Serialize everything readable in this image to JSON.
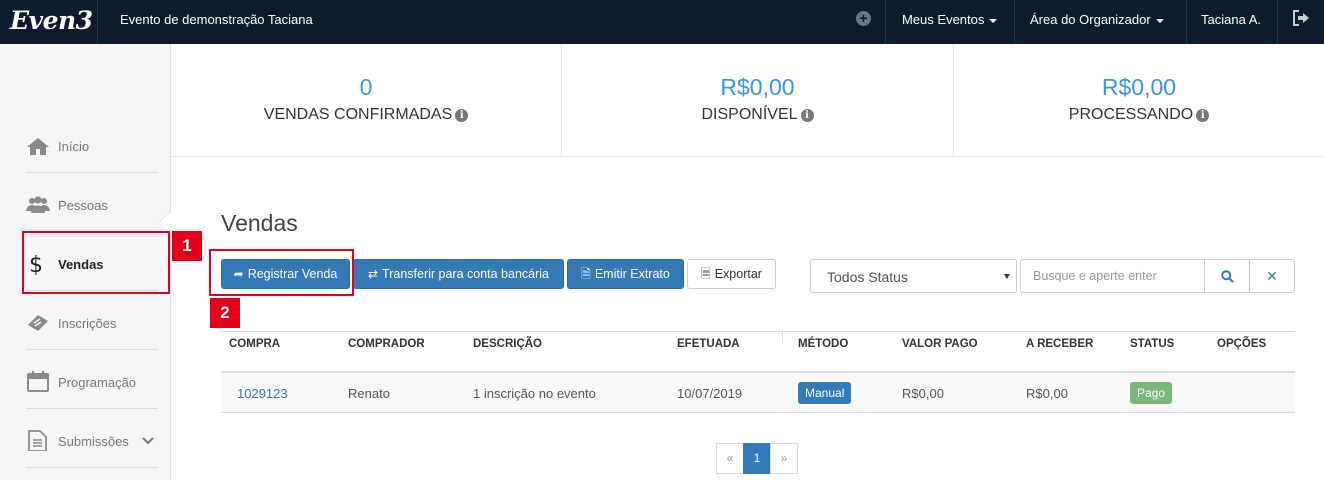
{
  "topbar": {
    "logo": "Even3",
    "event_title": "Evento de demonstração Taciana",
    "meus_eventos": "Meus Eventos",
    "area_organizador": "Área do Organizador",
    "user": "Taciana A."
  },
  "sidebar": {
    "items": [
      {
        "label": "Início",
        "icon": "home-icon"
      },
      {
        "label": "Pessoas",
        "icon": "users-icon"
      },
      {
        "label": "Vendas",
        "icon": "dollar-icon",
        "active": true
      },
      {
        "label": "Inscrições",
        "icon": "ticket-icon"
      },
      {
        "label": "Programação",
        "icon": "calendar-icon"
      },
      {
        "label": "Submissões",
        "icon": "document-icon"
      }
    ]
  },
  "stats": [
    {
      "value": "0",
      "label": "VENDAS CONFIRMADAS"
    },
    {
      "value": "R$0,00",
      "label": "DISPONÍVEL"
    },
    {
      "value": "R$0,00",
      "label": "PROCESSANDO"
    }
  ],
  "main": {
    "title": "Vendas",
    "buttons": {
      "registrar": "Registrar Venda",
      "transferir": "Transferir para conta bancária",
      "extrato": "Emitir Extrato",
      "exportar": "Exportar"
    },
    "status_filter": "Todos Status",
    "search_placeholder": "Busque e aperte enter"
  },
  "table": {
    "headers": [
      "COMPRA",
      "COMPRADOR",
      "DESCRIÇÃO",
      "EFETUADA",
      "MÉTODO",
      "VALOR PAGO",
      "A RECEBER",
      "STATUS",
      "OPÇÕES"
    ],
    "rows": [
      {
        "compra": "1029123",
        "comprador": "Renato",
        "descricao": "1 inscrição no evento",
        "efetuada": "10/07/2019",
        "metodo": "Manual",
        "valor_pago": "R$0,00",
        "a_receber": "R$0,00",
        "status": "Pago"
      }
    ]
  },
  "pagination": {
    "prev": "«",
    "current": "1",
    "next": "»"
  },
  "annotations": {
    "one": "1",
    "two": "2"
  },
  "colors": {
    "topbar": "#0f1b2c",
    "accent": "#3b95e0",
    "primary": "#337ab7",
    "success": "#7cb67c",
    "annotation": "#e3001b"
  }
}
